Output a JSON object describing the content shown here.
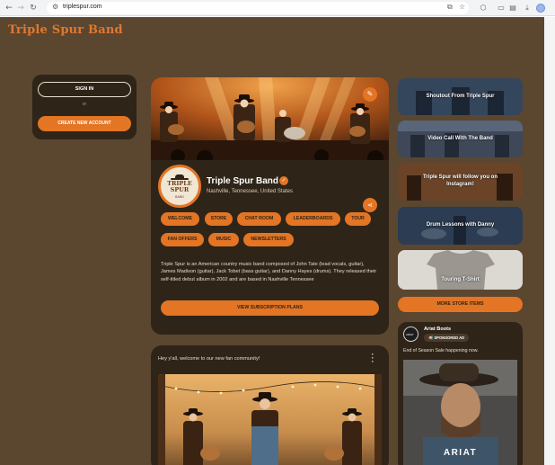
{
  "browser": {
    "url": "triplespur.com"
  },
  "site": {
    "logo": "Triple Spur Band"
  },
  "login": {
    "sign_in": "SIGN IN",
    "or": "or",
    "create_account": "CREATE NEW ACCOUNT"
  },
  "profile": {
    "avatar_text": "TRIPLE SPUR",
    "avatar_sub": "BAND",
    "name": "Triple Spur Band",
    "location": "Nashville, Tennessee, United States",
    "pills": [
      "WELCOME",
      "STORE",
      "CHAT ROOM",
      "LEADERBOARDS",
      "TOUR",
      "FAN OFFERS",
      "MUSIC",
      "NEWSLETTERS"
    ],
    "description": "Triple Spur is an American country music band composed of John Tate (lead vocals, guitar), James Madison (guitar), Jack Tobet (bass guitar), and Danny Hayes (drums). They released their self-titled debut album in 2002 and are based in Nashville Tennessee",
    "subscribe": "VIEW SUBSCRIPTION PLANS"
  },
  "post": {
    "text": "Hey y'all, welcome to our new fan community!"
  },
  "sidebar": {
    "thumbs": [
      "Shoutout From Triple Spur",
      "Video Call With The Band",
      "Triple Spur will follow you on Instagram!",
      "Drum Lessons with Danny",
      "Touring T-Shirt"
    ],
    "store_button": "MORE STORE ITEMS"
  },
  "ad": {
    "avatar_text": "ARIAT",
    "name": "Ariat Boots",
    "badge": "SPONSORED AD",
    "text": "End of Season Sale happening now.",
    "brand": "ARIAT"
  },
  "colors": {
    "page_bg": "#5b4630",
    "card_bg": "#2f2418",
    "accent": "#e37524"
  }
}
